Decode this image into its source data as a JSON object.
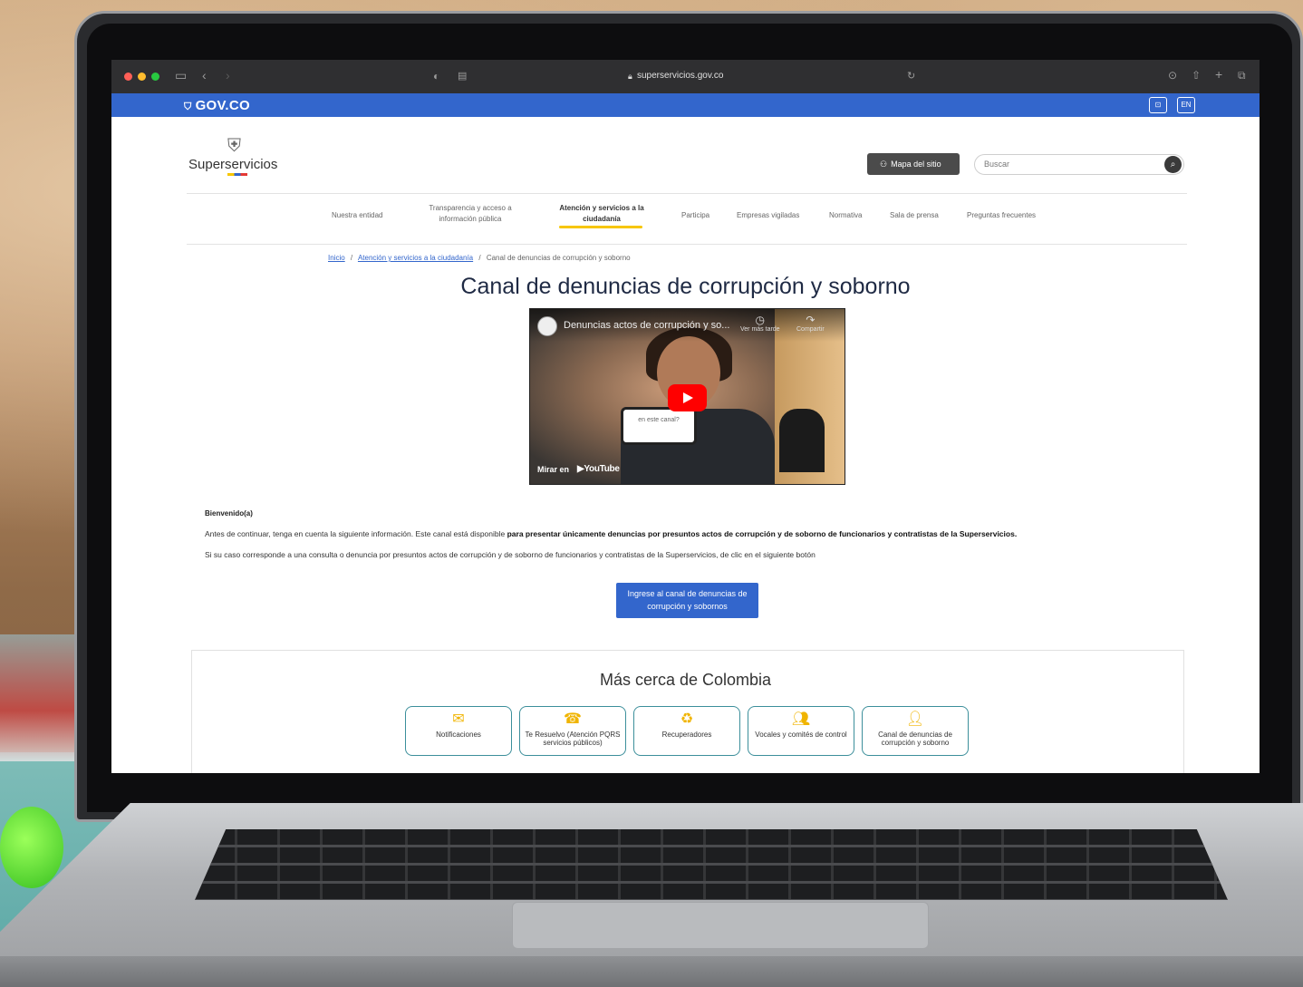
{
  "browser": {
    "url": "superservicios.gov.co"
  },
  "govbar": {
    "logo": "GOV.CO",
    "lang_button": "EN",
    "accessibility_button": "⊡"
  },
  "header": {
    "brand": "Superservicios",
    "sitemap_label": "Mapa del sitio",
    "search_placeholder": "Buscar"
  },
  "nav": {
    "items": [
      {
        "label": "Nuestra entidad"
      },
      {
        "label": "Transparencia y acceso a información pública"
      },
      {
        "label": "Atención y servicios a la ciudadanía"
      },
      {
        "label": "Participa"
      },
      {
        "label": "Empresas vigiladas"
      },
      {
        "label": "Normativa"
      },
      {
        "label": "Sala de prensa"
      },
      {
        "label": "Preguntas frecuentes"
      }
    ],
    "active_index": 2
  },
  "breadcrumb": {
    "home": "Inicio",
    "section": "Atención y servicios a la ciudadanía",
    "current": "Canal de denuncias de corrupción y soborno",
    "separator": "/"
  },
  "page": {
    "title": "Canal de denuncias de corrupción y soborno"
  },
  "video": {
    "title": "Denuncias actos de corrupción y so...",
    "watch_later": "Ver más tarde",
    "share": "Compartir",
    "phone_text": "en este canal?",
    "watch_on": "Mirar en",
    "platform": "YouTube"
  },
  "content": {
    "welcome": "Bienvenido(a)",
    "para1_prefix": "Antes de continuar, tenga en cuenta la siguiente información. Este canal está disponible ",
    "para1_bold": "para presentar únicamente denuncias por presuntos actos de corrupción y de soborno de funcionarios y contratistas de la Superservicios.",
    "para2": "Si su caso corresponde a una consulta o denuncia por presuntos actos de corrupción y de soborno de funcionarios y contratistas de la Superservicios, de clic en el siguiente botón",
    "cta": "Ingrese al canal de denuncias de corrupción y sobornos"
  },
  "section": {
    "title": "Más cerca de Colombia",
    "tiles": [
      {
        "label": "Notificaciones",
        "icon": "mail-icon"
      },
      {
        "label": "Te Resuelvo (Atención PQRS servicios públicos)",
        "icon": "speaker-icon"
      },
      {
        "label": "Recuperadores",
        "icon": "recycle-icon"
      },
      {
        "label": "Vocales y comités de control",
        "icon": "group-icon"
      },
      {
        "label": "Canal de denuncias de corrupción y soborno",
        "icon": "person-icon"
      }
    ]
  },
  "colors": {
    "gov_blue": "#3366cc",
    "accent_yellow": "#f7c600",
    "tile_border": "#3c8f9b"
  }
}
